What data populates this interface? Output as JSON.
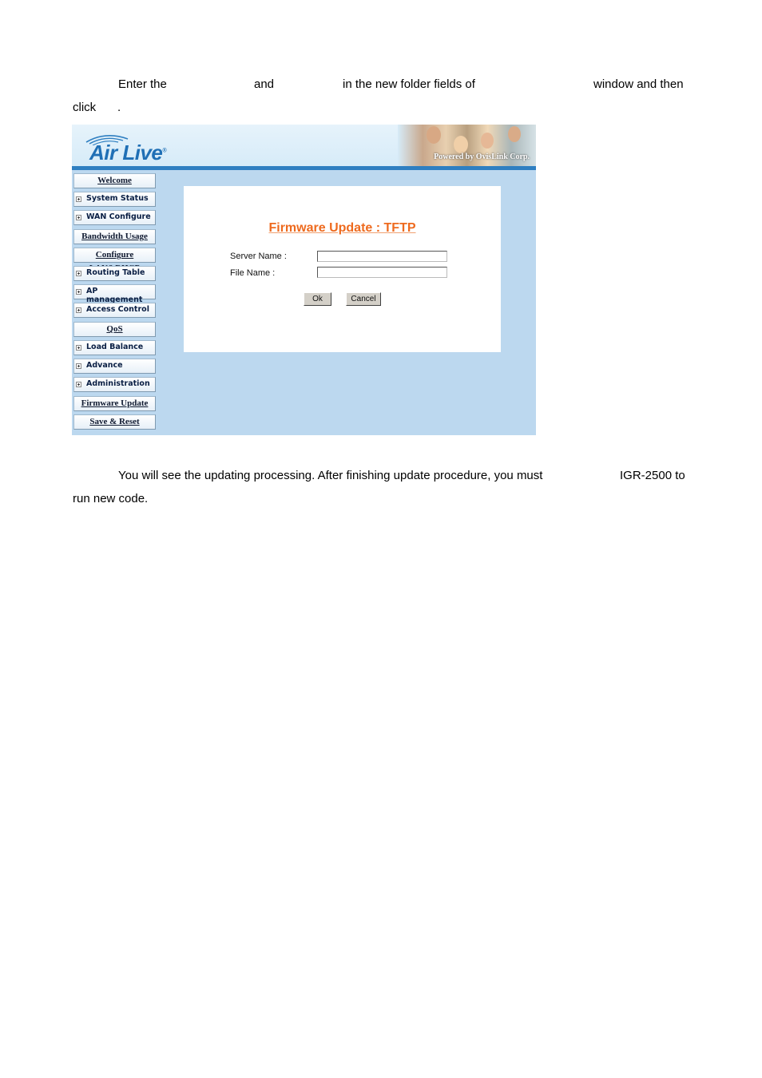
{
  "document": {
    "paragraph1": {
      "line1": [
        "Enter the",
        "and",
        "in the new folder fields of",
        "window and then"
      ],
      "line2": [
        "click",
        "."
      ]
    },
    "paragraph2": {
      "line1": [
        "You will see the updating processing. After finishing update procedure, you must",
        "IGR-2500 to"
      ],
      "line2": [
        "run new code."
      ]
    }
  },
  "screenshot": {
    "brand": {
      "logo_text": "Air Live",
      "registered_mark": "®",
      "powered_by": "Powered by OvisLink Corp."
    },
    "nav": [
      {
        "label": "Welcome",
        "expandable": false
      },
      {
        "label": "System Status",
        "expandable": true
      },
      {
        "label": "WAN Configure",
        "expandable": true
      },
      {
        "label": "Bandwidth Usage",
        "expandable": false
      },
      {
        "label": "Configure LAN&DHCP",
        "expandable": false
      },
      {
        "label": "Routing Table",
        "expandable": true
      },
      {
        "label": "AP management",
        "expandable": true
      },
      {
        "label": "Access Control",
        "expandable": true
      },
      {
        "label": "QoS",
        "expandable": false
      },
      {
        "label": "Load Balance",
        "expandable": true
      },
      {
        "label": "Advance",
        "expandable": true
      },
      {
        "label": "Administration",
        "expandable": true
      },
      {
        "label": "Firmware Update",
        "expandable": false
      },
      {
        "label": "Save & Reset",
        "expandable": false
      }
    ],
    "form": {
      "title": "Firmware Update : TFTP",
      "server_name_label": "Server Name :",
      "server_name_value": "",
      "file_name_label": "File Name :",
      "file_name_value": "",
      "ok_label": "Ok",
      "cancel_label": "Cancel"
    },
    "colors": {
      "title_orange": "#ee6a1e",
      "content_bg": "#bcd8ef",
      "banner_bar": "#2f7fc1",
      "logo_blue": "#1f6fb5"
    }
  }
}
